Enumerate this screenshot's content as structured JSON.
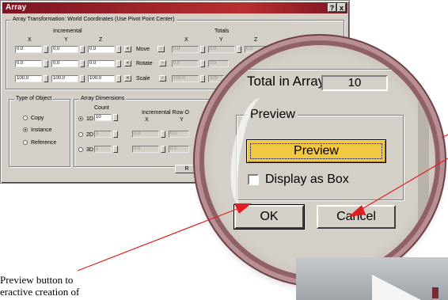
{
  "dialog": {
    "title": "Array",
    "help_btn": "?",
    "close_btn": "x",
    "transform_group": "Array Transformation: World Coordinates (Use Pivot Point Center)",
    "incremental": "Incremental",
    "totals": "Totals",
    "axis_x": "X",
    "axis_y": "Y",
    "axis_z": "Z",
    "row_move": {
      "label": "Move",
      "values": [
        "0.0",
        "0.0",
        "0.0"
      ],
      "totals": [
        "0.0",
        "0.0",
        "0.0"
      ]
    },
    "row_rotate": {
      "label": "Rotate",
      "values": [
        "0.0",
        "0.0",
        "0.0"
      ],
      "totals": [
        "0.0",
        "0.0"
      ]
    },
    "row_scale": {
      "label": "Scale",
      "values": [
        "100.0",
        "100.0",
        "100.0"
      ],
      "totals": [
        "100.0",
        "100"
      ]
    },
    "arrow_left": "<",
    "arrow_right": ">",
    "type_group": "Type of Object",
    "type_copy": "Copy",
    "type_instance": "Instance",
    "type_reference": "Reference",
    "dims_group": "Array Dimensions",
    "count_label": "Count",
    "inc_row_label": "Incremental Row O",
    "dim_1d": "1D",
    "dim_2d": "2D",
    "dim_3d": "3D",
    "count_1d": "10",
    "count_2d": "1",
    "count_3d": "1",
    "offset_2d": [
      "0.0",
      "0.0"
    ],
    "offset_3d": [
      "0.0",
      "0.0"
    ],
    "reset_partial": "R"
  },
  "magnified": {
    "total_label": "Total in Array:",
    "total_value": "10",
    "preview_group": "Preview",
    "preview_button": "Preview",
    "display_as_box": "Display as Box",
    "display_as_box_checked": false,
    "ok": "OK",
    "cancel": "Cancel"
  },
  "annotation": {
    "line1": "Preview button to",
    "line2": "eractive creation of"
  },
  "colors": {
    "title_bar": "#9c2430",
    "preview_button": "#f2c840",
    "arrow": "#e02020",
    "lens_frame": "#8f6066"
  }
}
